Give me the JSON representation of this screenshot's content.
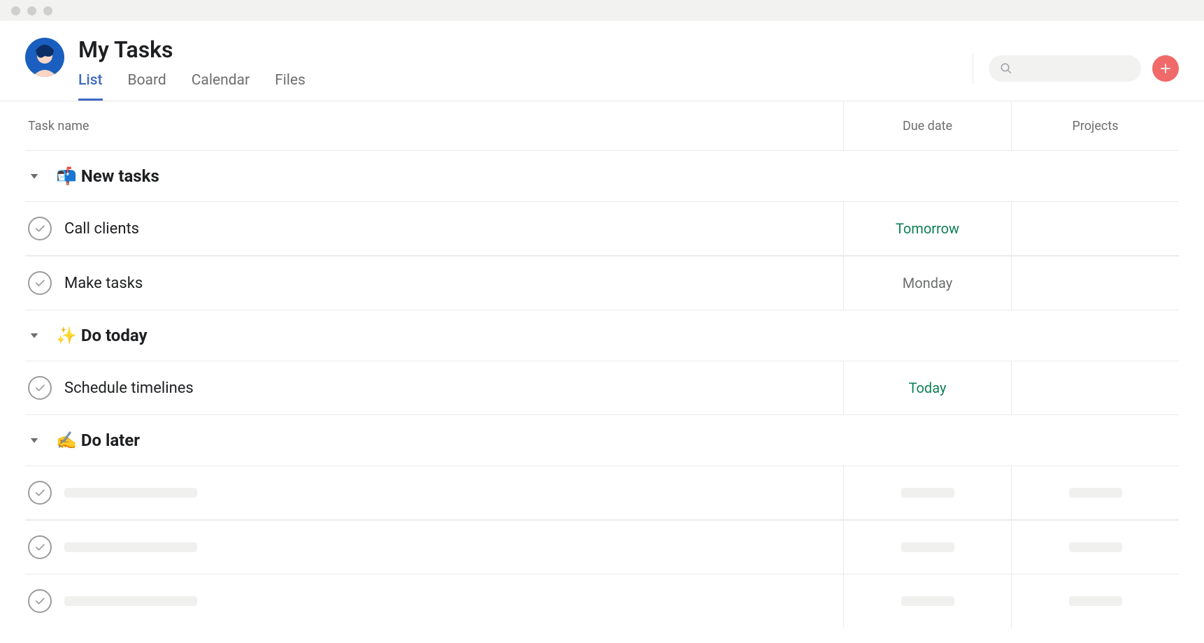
{
  "header": {
    "title": "My Tasks",
    "tabs": [
      {
        "label": "List",
        "active": true
      },
      {
        "label": "Board",
        "active": false
      },
      {
        "label": "Calendar",
        "active": false
      },
      {
        "label": "Files",
        "active": false
      }
    ],
    "search_placeholder": "",
    "avatar_colors": {
      "bg": "#1a5fbf",
      "face": "#f9d5c6",
      "hair": "#0c2e66"
    }
  },
  "columns": {
    "name": "Task name",
    "due": "Due date",
    "projects": "Projects"
  },
  "sections": [
    {
      "icon": "📬",
      "title": "New tasks",
      "tasks": [
        {
          "name": "Call clients",
          "due": "Tomorrow",
          "due_style": "green",
          "project": ""
        },
        {
          "name": "Make tasks",
          "due": "Monday",
          "due_style": "grey",
          "project": ""
        }
      ]
    },
    {
      "icon": "✨",
      "title": "Do today",
      "tasks": [
        {
          "name": "Schedule timelines",
          "due": "Today",
          "due_style": "green",
          "project": ""
        }
      ]
    },
    {
      "icon": "✍️",
      "title": "Do later",
      "tasks": [
        {
          "placeholder": true
        },
        {
          "placeholder": true
        },
        {
          "placeholder": true
        }
      ]
    }
  ]
}
